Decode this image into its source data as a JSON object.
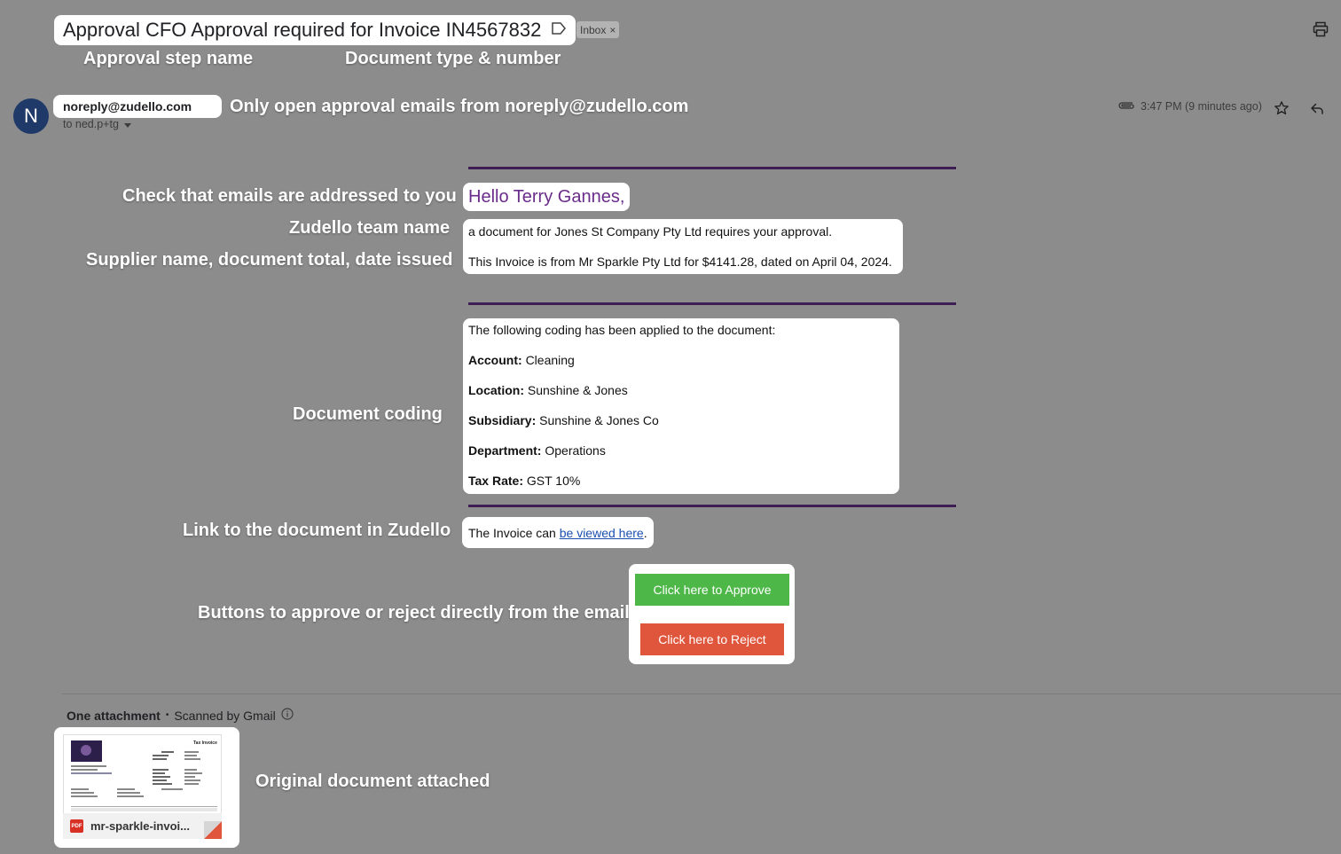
{
  "email": {
    "subject": "Approval CFO Approval required for Invoice IN4567832",
    "inbox_label": "Inbox",
    "sender_initial": "N",
    "sender_email": "noreply@zudello.com",
    "recipient": "to ned.p+tg",
    "time": "3:47 PM (9 minutes ago)",
    "greeting": "Hello Terry Gannes,",
    "intro_line1": "a document for Jones St Company Pty Ltd requires your approval.",
    "intro_line2": "This Invoice is from Mr Sparkle Pty Ltd for $4141.28, dated on April 04, 2024.",
    "coding_heading": "The following coding has been applied to the document:",
    "coding": [
      {
        "label": "Account:",
        "value": "Cleaning"
      },
      {
        "label": "Location:",
        "value": "Sunshine & Jones"
      },
      {
        "label": "Subsidiary:",
        "value": "Sunshine & Jones Co"
      },
      {
        "label": "Department:",
        "value": "Operations"
      },
      {
        "label": "Tax Rate:",
        "value": "GST 10%"
      }
    ],
    "link_prefix": "The Invoice can ",
    "link_text": "be viewed here",
    "link_suffix": ".",
    "approve_label": "Click here to Approve",
    "reject_label": "Click here to Reject"
  },
  "attachments": {
    "count_label": "One attachment",
    "separator": "•",
    "scan_label": "Scanned by Gmail",
    "file_name": "mr-sparkle-invoi...",
    "file_type": "PDF",
    "thumb_title": "Tax Invoice"
  },
  "annotations": {
    "approval_step": "Approval step name",
    "doc_type": "Document type & number",
    "sender_only": "Only open approval emails from noreply@zudello.com",
    "addressed": "Check that emails are addressed to you",
    "team_name": "Zudello team name",
    "supplier": "Supplier name, document total, date issued",
    "coding": "Document coding",
    "link": "Link to the document in Zudello",
    "buttons": "Buttons to approve or reject directly from the email",
    "original": "Original document attached"
  },
  "colors": {
    "background": "#8c8c8c",
    "divider": "#3d1f55",
    "greeting": "#6a2c8a",
    "approve": "#4db748",
    "reject": "#e0563c",
    "avatar": "#1f3a68"
  }
}
